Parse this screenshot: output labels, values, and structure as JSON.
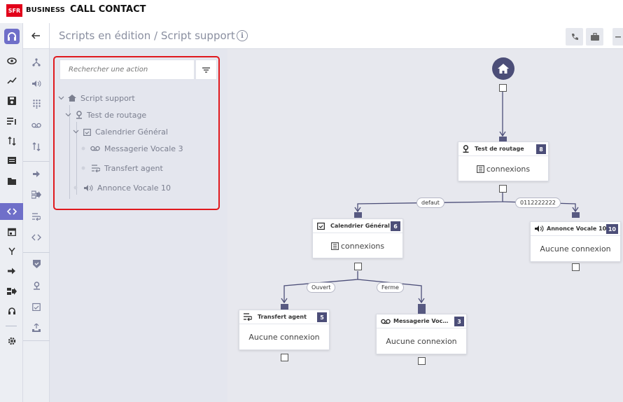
{
  "app": {
    "logo": "SFR",
    "brand": "BUSINESS",
    "title": "CALL CONTACT"
  },
  "header": {
    "breadcrumb": "Scripts en édition / Script support",
    "info_glyph": "i"
  },
  "search": {
    "placeholder": "Rechercher une action"
  },
  "tree": {
    "root": "Script support",
    "routage": "Test de routage",
    "calendrier": "Calendrier Général",
    "messagerie": "Messagerie Vocale 3",
    "transfert": "Transfert agent",
    "annonce": "Annonce Vocale 10"
  },
  "nodes": {
    "routage": {
      "title": "Test de routage",
      "badge": "8",
      "body": "connexions"
    },
    "calendrier": {
      "title": "Calendrier Général",
      "badge": "6",
      "body": "connexions"
    },
    "annonce": {
      "title": "Annonce Vocale 10",
      "badge": "10",
      "body": "Aucune connexion"
    },
    "transfert": {
      "title": "Transfert agent",
      "badge": "5",
      "body": "Aucune connexion"
    },
    "messagerie": {
      "title": "Messagerie Voc…",
      "badge": "3",
      "body": "Aucune connexion"
    }
  },
  "edges": {
    "defaut": "defaut",
    "number": "0112222222",
    "ouvert": "Ouvert",
    "ferme": "Ferme"
  },
  "colors": {
    "accent": "#6f6fc9",
    "brand_red": "#e2001a",
    "badge": "#4c4e78",
    "highlight": "#e0191e"
  }
}
